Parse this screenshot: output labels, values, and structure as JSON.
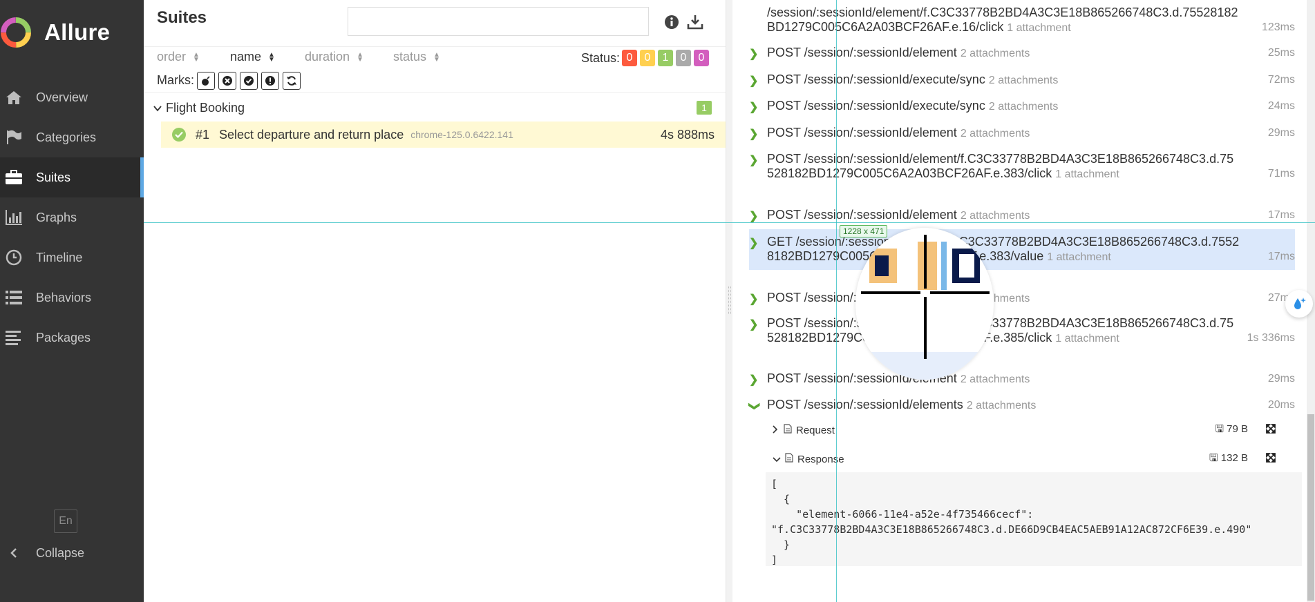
{
  "app": {
    "brand": "Allure"
  },
  "sidebar": {
    "items": [
      {
        "label": "Overview",
        "icon": "home-icon"
      },
      {
        "label": "Categories",
        "icon": "flag-icon"
      },
      {
        "label": "Suites",
        "icon": "briefcase-icon",
        "active": true
      },
      {
        "label": "Graphs",
        "icon": "bar-chart-icon"
      },
      {
        "label": "Timeline",
        "icon": "clock-icon"
      },
      {
        "label": "Behaviors",
        "icon": "list-icon"
      },
      {
        "label": "Packages",
        "icon": "align-left-icon"
      }
    ],
    "language": "En",
    "collapse": "Collapse"
  },
  "suites": {
    "title": "Suites",
    "search": {
      "value": "",
      "placeholder": ""
    },
    "sort": {
      "order": "order",
      "name": "name",
      "duration": "duration",
      "status": "status"
    },
    "status_label": "Status:",
    "status_counts": [
      {
        "value": "0",
        "color": "#fd5a3e"
      },
      {
        "value": "0",
        "color": "#ffd050"
      },
      {
        "value": "1",
        "color": "#97cc64"
      },
      {
        "value": "0",
        "color": "#aaaaaa"
      },
      {
        "value": "0",
        "color": "#d35ebe"
      }
    ],
    "marks_label": "Marks:",
    "group": {
      "name": "Flight Booking",
      "count": "1"
    },
    "test": {
      "number": "#1",
      "name": "Select departure and return place",
      "parameter": "chrome-125.0.6422.141",
      "duration": "4s 888ms"
    }
  },
  "steps": [
    {
      "text": "/session/:sessionId/element/f.C3C33778B2BD4A3C3E18B865266748C3.d.75528182BD1279C005C6A2A03BCF26AF.e.16/click",
      "attachments": "1 attachment",
      "duration": "123ms"
    },
    {
      "text": "POST /session/:sessionId/element",
      "attachments": "2 attachments",
      "duration": "25ms"
    },
    {
      "text": "POST /session/:sessionId/execute/sync",
      "attachments": "2 attachments",
      "duration": "72ms"
    },
    {
      "text": "POST /session/:sessionId/execute/sync",
      "attachments": "2 attachments",
      "duration": "24ms"
    },
    {
      "text": "POST /session/:sessionId/element",
      "attachments": "2 attachments",
      "duration": "29ms"
    },
    {
      "text": "POST /session/:sessionId/element/f.C3C33778B2BD4A3C3E18B865266748C3.d.75528182BD1279C005C6A2A03BCF26AF.e.383/click",
      "attachments": "1 attachment",
      "duration": "71ms"
    },
    {
      "text": "POST /session/:sessionId/element",
      "attachments": "2 attachments",
      "duration": "17ms"
    },
    {
      "text": "GET /session/:sessionId/element/f.C3C33778B2BD4A3C3E18B865266748C3.d.75528182BD1279C005C6A2A03BCF26AF.e.383/value",
      "attachments": "1 attachment",
      "duration": "17ms"
    },
    {
      "text": "POST /session/:sessionId/element",
      "attachments": "2 attachments",
      "duration": "27ms"
    },
    {
      "text": "POST /session/:sessionId/element/f.C3C33778B2BD4A3C3E18B865266748C3.d.75528182BD1279C005C6A2A03BCF26AF.e.385/click",
      "attachments": "1 attachment",
      "duration": "1s 336ms"
    },
    {
      "text": "POST /session/:sessionId/element",
      "attachments": "2 attachments",
      "duration": "29ms"
    },
    {
      "text": "POST /session/:sessionId/elements",
      "attachments": "2 attachments",
      "duration": "20ms"
    }
  ],
  "attachments": [
    {
      "name": "Request",
      "size": "79 B"
    },
    {
      "name": "Response",
      "size": "132 B"
    }
  ],
  "response_body": "[\n  {\n    \"element-6066-11e4-a52e-4f735466cecf\":\n\"f.C3C33778B2BD4A3C3E18B865266748C3.d.DE66D9CB4EAC5AEB91A12AC872CF6E39.e.490\"\n  }\n]",
  "overlay": {
    "dimensions": "1228 x 471"
  }
}
